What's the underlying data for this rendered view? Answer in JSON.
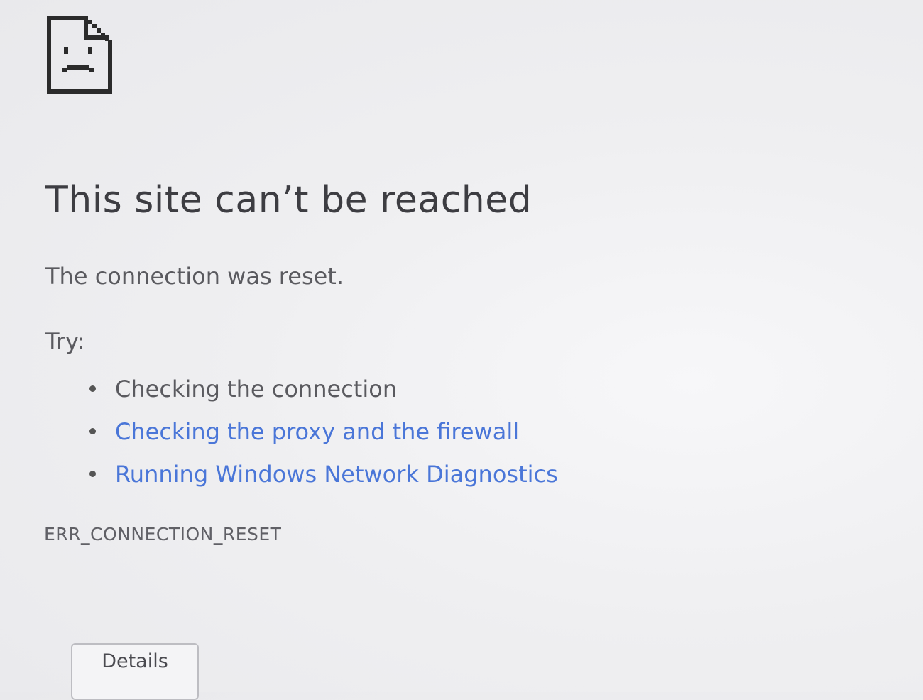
{
  "icon": "sad-page-icon",
  "title": "This site can’t be reached",
  "message": "The connection was reset.",
  "try_label": "Try:",
  "suggestions": [
    {
      "text": "Checking the connection",
      "is_link": false
    },
    {
      "text": "Checking the proxy and the firewall",
      "is_link": true
    },
    {
      "text": "Running Windows Network Diagnostics",
      "is_link": true
    }
  ],
  "error_code": "ERR_CONNECTION_RESET",
  "details_button_label": "Details",
  "colors": {
    "link": "#4a76d8",
    "text": "#5a5a5f",
    "title": "#3d3d42"
  }
}
